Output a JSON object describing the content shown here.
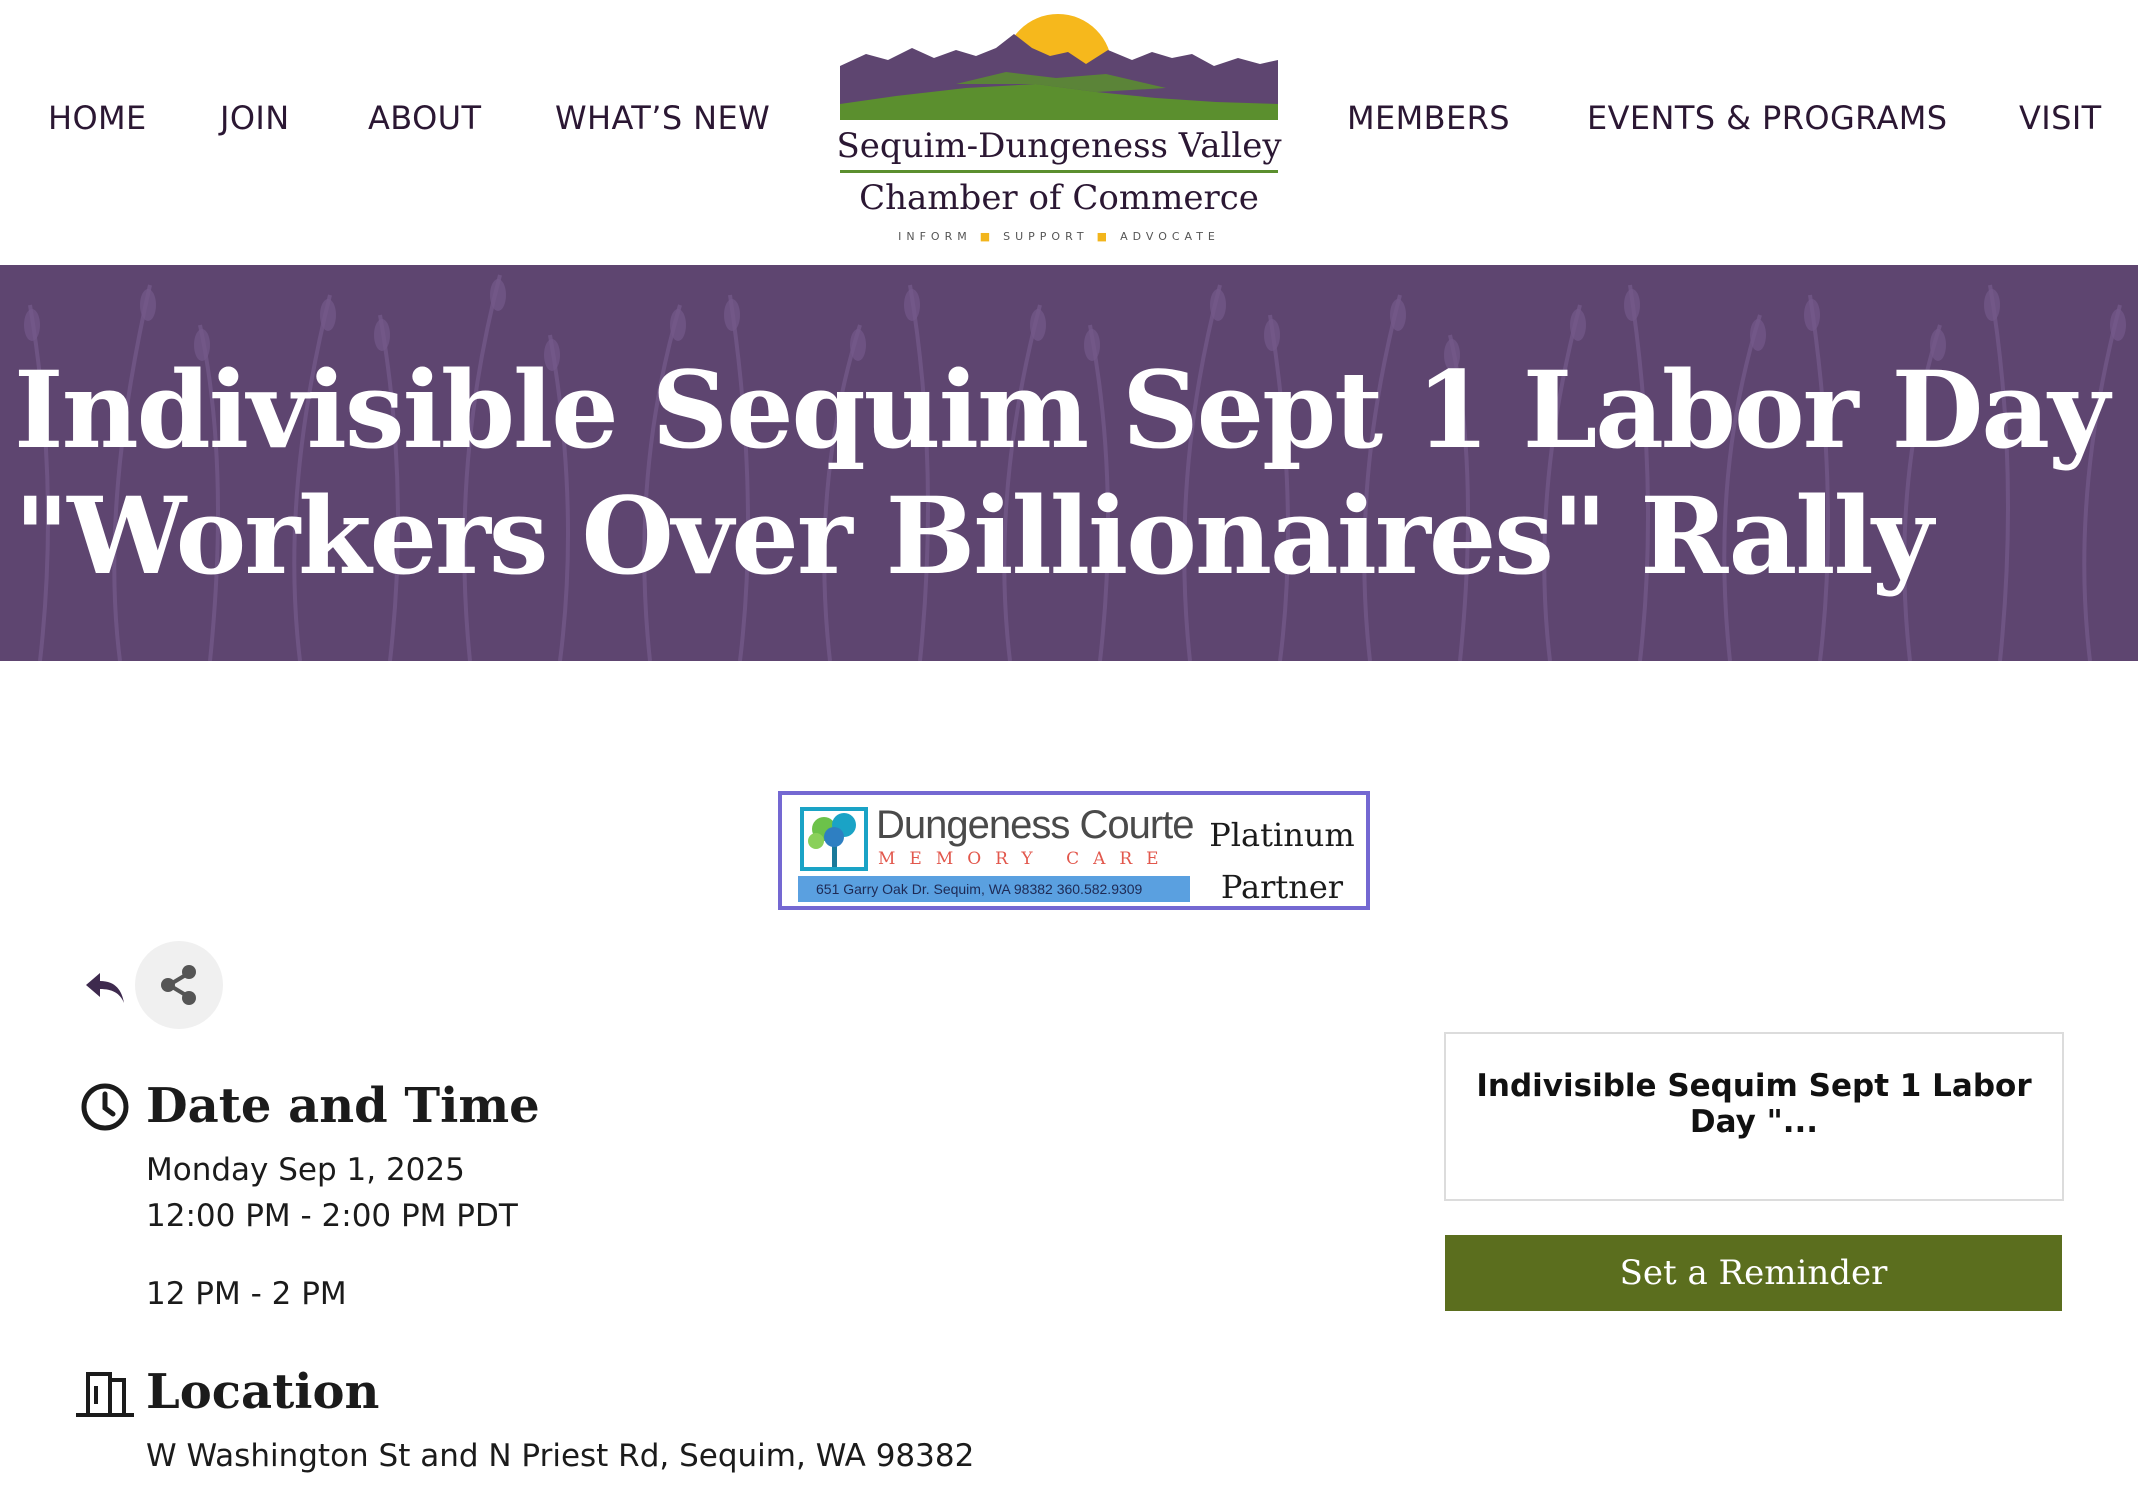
{
  "nav": {
    "left": [
      "HOME",
      "JOIN",
      "ABOUT",
      "WHAT’S NEW"
    ],
    "right": [
      "MEMBERS",
      "EVENTS & PROGRAMS",
      "VISIT"
    ]
  },
  "logo": {
    "line1": "Sequim-Dungeness Valley",
    "line2": "Chamber of Commerce",
    "tagline": [
      "INFORM",
      "SUPPORT",
      "ADVOCATE"
    ],
    "colors": {
      "sun": "#f6b81c",
      "mountains": "#5e4570",
      "hills": "#5b8f2e"
    }
  },
  "hero": {
    "title": "Indivisible Sequim Sept 1 Labor Day \"Workers Over Billionaires\" Rally",
    "background": "#5e4570"
  },
  "sponsor": {
    "brand": "Dungeness Courte",
    "subtitle": "MEMORY CARE",
    "address": "651 Garry Oak Dr. Sequim, WA 98382   360.582.9309",
    "tier_line1": "Platinum",
    "tier_line2": "Partner",
    "border_color": "#7468d2"
  },
  "actions": {
    "back_icon": "reply-arrow-icon",
    "share_icon": "share-icon"
  },
  "date_time": {
    "heading": "Date and Time",
    "date": "Monday Sep 1, 2025",
    "time": "12:00 PM - 2:00 PM PDT",
    "note": "12 PM - 2 PM",
    "icon": "clock-icon"
  },
  "location": {
    "heading": "Location",
    "address": "W Washington St and N Priest Rd, Sequim, WA 98382",
    "icon": "building-icon"
  },
  "card": {
    "title": "Indivisible Sequim Sept 1 Labor Day \"..."
  },
  "reminder": {
    "label": "Set a Reminder",
    "color": "#5b6e1e"
  }
}
